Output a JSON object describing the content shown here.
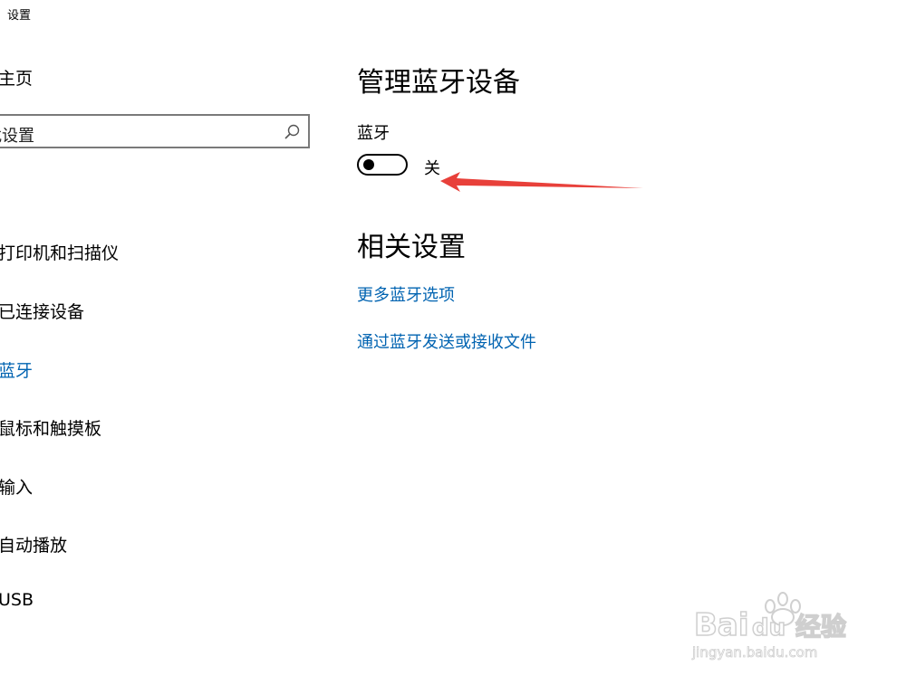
{
  "window": {
    "title": "设置"
  },
  "sidebar": {
    "home_label": "主页",
    "search_placeholder": "找设置",
    "items": [
      {
        "label": "打印机和扫描仪"
      },
      {
        "label": "已连接设备"
      },
      {
        "label": "蓝牙",
        "active": true
      },
      {
        "label": "鼠标和触摸板"
      },
      {
        "label": "输入"
      },
      {
        "label": "自动播放"
      },
      {
        "label": "USB"
      }
    ]
  },
  "main": {
    "title": "管理蓝牙设备",
    "bluetooth_label": "蓝牙",
    "toggle_state": "关",
    "related_title": "相关设置",
    "links": [
      {
        "label": "更多蓝牙选项"
      },
      {
        "label": "通过蓝牙发送或接收文件"
      }
    ]
  },
  "watermark": {
    "brand": "Bai",
    "brand2": "du",
    "brand_cn": "经验",
    "url": "jingyan.baidu.com"
  },
  "colors": {
    "accent": "#0063b1",
    "arrow": "#e8403a"
  }
}
